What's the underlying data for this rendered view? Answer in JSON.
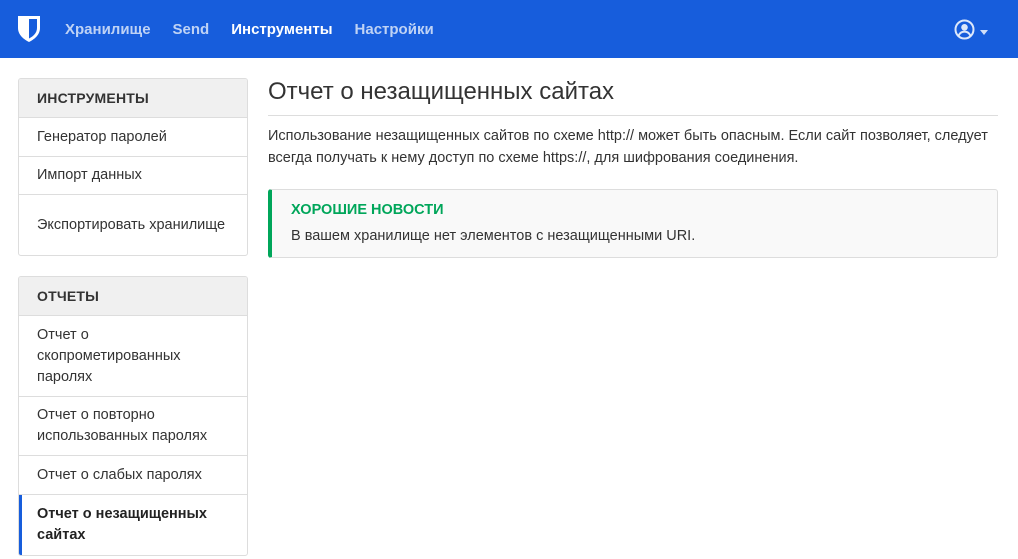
{
  "navbar": {
    "brand_icon": "bitwarden-shield-icon",
    "links": [
      {
        "label": "Хранилище",
        "active": false
      },
      {
        "label": "Send",
        "active": false
      },
      {
        "label": "Инструменты",
        "active": true
      },
      {
        "label": "Настройки",
        "active": false
      }
    ],
    "account_icon": "user-circle-icon"
  },
  "sidebar": {
    "tools": {
      "header": "ИНСТРУМЕНТЫ",
      "items": [
        {
          "label": "Генератор паролей"
        },
        {
          "label": "Импорт данных"
        },
        {
          "label": "Экспортировать хранилище"
        }
      ]
    },
    "reports": {
      "header": "ОТЧЕТЫ",
      "items": [
        {
          "label": "Отчет о скопрометированных паролях"
        },
        {
          "label": "Отчет о повторно использованных паролях"
        },
        {
          "label": "Отчет о слабых паролях"
        },
        {
          "label": "Отчет о незащищенных сайтах",
          "active": true
        }
      ]
    }
  },
  "main": {
    "title": "Отчет о незащищенных сайтах",
    "description": "Использование незащищенных сайтов по схеме http:// может быть опасным. Если сайт позволяет, следует всегда получать к нему доступ по схеме https://, для шифрования соединения.",
    "callout": {
      "title": "ХОРОШИЕ НОВОСТИ",
      "text": "В вашем хранилище нет элементов с незащищенными URI."
    }
  },
  "colors": {
    "navbar": "#175ddc",
    "success": "#00a65a",
    "active_indicator": "#175ddc"
  }
}
